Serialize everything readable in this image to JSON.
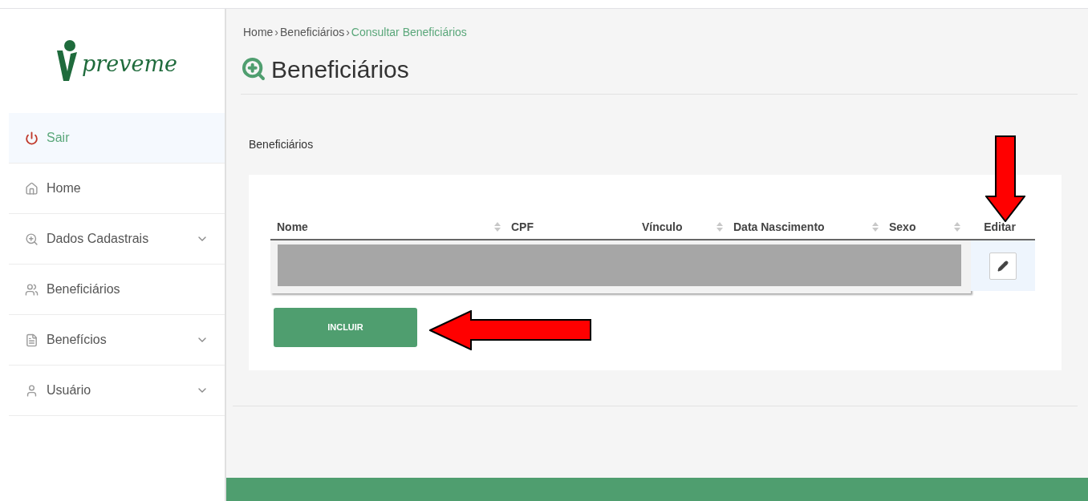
{
  "logo": {
    "text": "preveme"
  },
  "sidebar": {
    "items": [
      {
        "label": "Sair",
        "selected": true,
        "kind": "link"
      },
      {
        "label": "Home",
        "selected": false,
        "kind": "link"
      },
      {
        "label": "Dados Cadastrais",
        "selected": false,
        "kind": "submenu"
      },
      {
        "label": "Beneficiários",
        "selected": false,
        "kind": "link"
      },
      {
        "label": "Benefícios",
        "selected": false,
        "kind": "submenu"
      },
      {
        "label": "Usuário",
        "selected": false,
        "kind": "submenu"
      }
    ]
  },
  "breadcrumb": [
    {
      "kind": "link",
      "label": "Home",
      "selected": false
    },
    {
      "kind": "separator",
      "label": "›"
    },
    {
      "kind": "link",
      "label": "Beneficiários",
      "selected": false
    },
    {
      "kind": "separator",
      "label": "›"
    },
    {
      "kind": "link",
      "label": "Consultar Beneficiários",
      "selected": true
    }
  ],
  "page_title": "Beneficiários",
  "section_label": "Beneficiários",
  "table": {
    "columns": [
      {
        "label": "Nome",
        "sortable": true
      },
      {
        "label": "CPF",
        "sortable": false
      },
      {
        "label": "Vínculo",
        "sortable": true
      },
      {
        "label": "Data Nascimento",
        "sortable": true
      },
      {
        "label": "Sexo",
        "sortable": true
      },
      {
        "label": "Editar",
        "sortable": false
      }
    ],
    "rows": [
      {
        "kind": "redacted"
      }
    ]
  },
  "add_button": "INCLUIR",
  "annotations": [
    {
      "kind": "arrow-down"
    },
    {
      "kind": "arrow-left"
    }
  ]
}
